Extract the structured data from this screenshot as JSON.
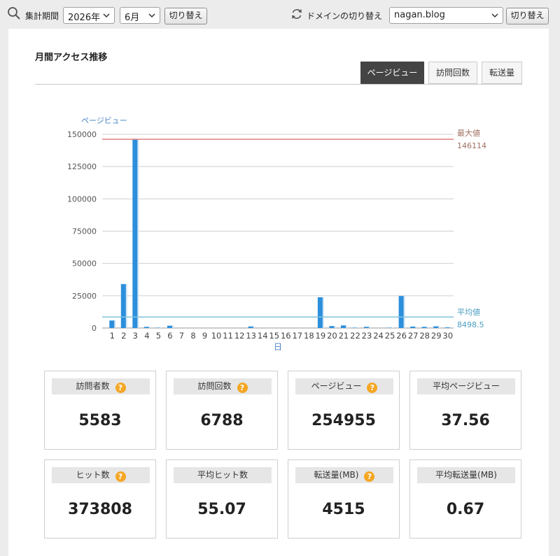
{
  "filter": {
    "period_label": "集計期間",
    "year_value": "2026年",
    "month_value": "6月",
    "switch_label": "切り替え",
    "domain_label": "ドメインの切り替え",
    "domain_value": "nagan.blog",
    "domain_switch_label": "切り替え"
  },
  "section": {
    "title": "月間アクセス推移",
    "tabs": [
      {
        "label": "ページビュー",
        "active": true
      },
      {
        "label": "訪問回数",
        "active": false
      },
      {
        "label": "転送量",
        "active": false
      }
    ]
  },
  "chart_data": {
    "type": "bar",
    "ylabel": "ページビュー",
    "xlabel": "日",
    "ylim": [
      0,
      150000
    ],
    "yticks": [
      0,
      25000,
      50000,
      75000,
      100000,
      125000,
      150000
    ],
    "categories": [
      "1",
      "2",
      "3",
      "4",
      "5",
      "6",
      "7",
      "8",
      "9",
      "10",
      "11",
      "12",
      "13",
      "14",
      "15",
      "16",
      "17",
      "18",
      "19",
      "20",
      "21",
      "22",
      "23",
      "24",
      "25",
      "26",
      "27",
      "28",
      "29",
      "30"
    ],
    "values": [
      5800,
      34000,
      146114,
      900,
      300,
      1800,
      0,
      0,
      0,
      0,
      0,
      0,
      1200,
      0,
      0,
      0,
      0,
      0,
      23800,
      1500,
      2000,
      300,
      900,
      0,
      300,
      24800,
      1100,
      900,
      1300,
      500
    ],
    "max_line": {
      "label": "最大値",
      "value": 146114,
      "value_text": "146114",
      "color": "#e08080"
    },
    "avg_line": {
      "label": "平均値",
      "value": 8498.5,
      "value_text": "8498.5",
      "color": "#7fc4dc"
    },
    "bar_color": "#2b8fdc",
    "grid": true
  },
  "stats": [
    {
      "label": "訪問者数",
      "value": "5583",
      "help": "?"
    },
    {
      "label": "訪問回数",
      "value": "6788",
      "help": "?"
    },
    {
      "label": "ページビュー",
      "value": "254955",
      "help": "?"
    },
    {
      "label": "平均ページビュー",
      "value": "37.56"
    },
    {
      "label": "ヒット数",
      "value": "373808",
      "help": "?"
    },
    {
      "label": "平均ヒット数",
      "value": "55.07"
    },
    {
      "label": "転送量(MB)",
      "value": "4515",
      "help": "?"
    },
    {
      "label": "平均転送量(MB)",
      "value": "0.67"
    }
  ],
  "icons": {
    "search": "search-icon",
    "refresh": "refresh-icon",
    "help": "help-icon",
    "dropdown": "chevron-down-icon"
  }
}
